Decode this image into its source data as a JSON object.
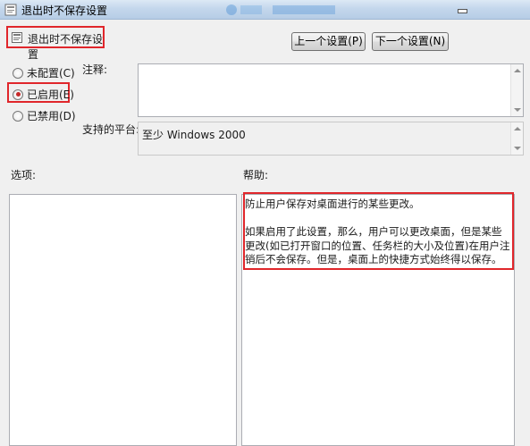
{
  "window": {
    "title": "退出时不保存设置"
  },
  "header": {
    "setting_name": "退出时不保存设置"
  },
  "buttons": {
    "prev": "上一个设置(P)",
    "next": "下一个设置(N)"
  },
  "radios": [
    {
      "label": "未配置(C)",
      "selected": false
    },
    {
      "label": "已启用(E)",
      "selected": true
    },
    {
      "label": "已禁用(D)",
      "selected": false
    }
  ],
  "labels": {
    "comment": "注释:",
    "platform": "支持的平台:",
    "options": "选项:",
    "help": "帮助:"
  },
  "platform": {
    "value": "至少 Windows 2000"
  },
  "help": {
    "text": "防止用户保存对桌面进行的某些更改。\n\n如果启用了此设置，那么，用户可以更改桌面，但是某些更改(如已打开窗口的位置、任务栏的大小及位置)在用户注销后不会保存。但是，桌面上的快捷方式始终得以保存。"
  },
  "colors": {
    "highlight": "#e0262b",
    "titlebar": "#c4d7ec",
    "window_bg": "#f0f0f0"
  }
}
